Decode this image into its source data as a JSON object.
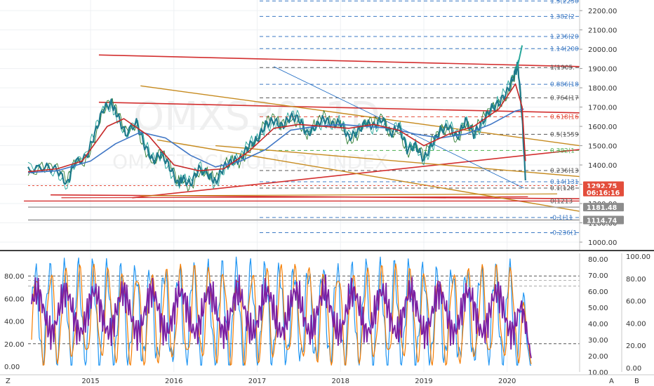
{
  "chart_data": [
    {
      "type": "line",
      "x_ticks": [
        "2015",
        "2016",
        "2017",
        "2018",
        "2019",
        "2020"
      ],
      "x_range": [
        2014.25,
        2020.87
      ],
      "y_ticks": [
        1000,
        1100,
        1200,
        1300,
        1400,
        1500,
        1600,
        1700,
        1800,
        1900,
        2000,
        2100,
        2200
      ],
      "y_tick_labels": [
        "1000.00",
        "1100.00",
        "1200.00",
        "1300.00",
        "1400.00",
        "1500.00",
        "1600.00",
        "1700.00",
        "1800.00",
        "1900.00",
        "2000.00",
        "2100.00",
        "2200.00"
      ],
      "ylim": [
        960,
        2255
      ],
      "watermark": [
        "OMXS30, 1D",
        "OMX STOCKHOLM 30 INDEX"
      ],
      "price_labels": [
        {
          "value": 1292.75,
          "text": "1292.75",
          "color": "#e34d3b"
        },
        {
          "value": 1259,
          "text": "06:16:16",
          "color": "#e34d3b"
        },
        {
          "value": 1181.48,
          "text": "1181.48",
          "color": "#8c8c8c"
        },
        {
          "value": 1114.74,
          "text": "1114.74",
          "color": "#8c8c8c"
        }
      ],
      "fib_levels": [
        {
          "value": 2250,
          "text": "1.5(2250",
          "color": "#3d7ac4"
        },
        {
          "value": 2170,
          "text": "1.382(2",
          "color": "#3d7ac4"
        },
        {
          "value": 2066,
          "text": "1.236(20",
          "color": "#3d7ac4"
        },
        {
          "value": 2003,
          "text": "1.14(200",
          "color": "#3d7ac4"
        },
        {
          "value": 1905,
          "text": "1(1905.",
          "color": "#555555"
        },
        {
          "value": 1818,
          "text": "0.886(18",
          "color": "#3d7ac4"
        },
        {
          "value": 1748,
          "text": "0.764(17",
          "color": "#555555"
        },
        {
          "value": 1650,
          "text": "0.618(16",
          "color": "#e34d3b"
        },
        {
          "value": 1559,
          "text": "0.5(1559",
          "color": "#555555"
        },
        {
          "value": 1475,
          "text": "0.382(1",
          "color": "#4caf50"
        },
        {
          "value": 1371,
          "text": "0.236(13",
          "color": "#555555"
        },
        {
          "value": 1313,
          "text": "0.14(131",
          "color": "#3d7ac4"
        },
        {
          "value": 1280,
          "text": "0.1(128",
          "color": "#555555"
        },
        {
          "value": 1213,
          "text": "0(1213",
          "color": "#555555"
        },
        {
          "value": 1128,
          "text": "-0.1(11",
          "color": "#3d7ac4"
        },
        {
          "value": 1049,
          "text": "-0.236(1",
          "color": "#3d7ac4"
        }
      ],
      "series": [
        {
          "style": "price",
          "color": "#1f7a8c",
          "x": [
            2014.25,
            2014.45,
            2014.6,
            2014.72,
            2014.8,
            2014.95,
            2015.05,
            2015.15,
            2015.25,
            2015.32,
            2015.42,
            2015.55,
            2015.65,
            2015.75,
            2015.85,
            2015.95,
            2016.05,
            2016.1,
            2016.2,
            2016.3,
            2016.42,
            2016.5,
            2016.6,
            2016.7,
            2016.8,
            2016.9,
            2017.0,
            2017.1,
            2017.2,
            2017.3,
            2017.4,
            2017.5,
            2017.6,
            2017.7,
            2017.8,
            2017.9,
            2018.0,
            2018.1,
            2018.2,
            2018.3,
            2018.4,
            2018.5,
            2018.6,
            2018.7,
            2018.8,
            2018.9,
            2019.0,
            2019.1,
            2019.2,
            2019.3,
            2019.4,
            2019.5,
            2019.6,
            2019.7,
            2019.8,
            2019.9,
            2020.0,
            2020.08,
            2020.13,
            2020.18,
            2020.22
          ],
          "y": [
            1370,
            1390,
            1375,
            1300,
            1410,
            1440,
            1560,
            1690,
            1720,
            1660,
            1560,
            1620,
            1500,
            1420,
            1460,
            1390,
            1300,
            1330,
            1300,
            1380,
            1350,
            1310,
            1390,
            1420,
            1430,
            1500,
            1530,
            1610,
            1630,
            1600,
            1650,
            1640,
            1560,
            1600,
            1640,
            1610,
            1620,
            1540,
            1570,
            1620,
            1600,
            1640,
            1560,
            1600,
            1480,
            1500,
            1430,
            1510,
            1580,
            1600,
            1540,
            1630,
            1560,
            1620,
            1690,
            1720,
            1780,
            1860,
            1920,
            1650,
            1320
          ]
        },
        {
          "style": "ma",
          "color": "#3f76c5",
          "x": [
            2014.25,
            2014.6,
            2015.0,
            2015.3,
            2015.6,
            2015.9,
            2016.2,
            2016.5,
            2016.8,
            2017.1,
            2017.4,
            2017.7,
            2018.0,
            2018.3,
            2018.6,
            2018.9,
            2019.2,
            2019.5,
            2019.8,
            2020.1,
            2020.2
          ],
          "y": [
            1360,
            1370,
            1420,
            1510,
            1570,
            1540,
            1450,
            1390,
            1420,
            1480,
            1580,
            1600,
            1610,
            1600,
            1590,
            1560,
            1540,
            1560,
            1610,
            1680,
            1690
          ]
        },
        {
          "style": "ma",
          "color": "#c62828",
          "x": [
            2014.25,
            2014.6,
            2014.9,
            2015.2,
            2015.4,
            2015.7,
            2016.0,
            2016.3,
            2016.6,
            2016.9,
            2017.2,
            2017.5,
            2017.8,
            2018.1,
            2018.4,
            2018.7,
            2019.0,
            2019.3,
            2019.6,
            2019.9,
            2020.1,
            2020.18,
            2020.22
          ],
          "y": [
            1365,
            1380,
            1420,
            1600,
            1640,
            1550,
            1400,
            1370,
            1380,
            1470,
            1590,
            1610,
            1600,
            1590,
            1610,
            1580,
            1500,
            1560,
            1600,
            1690,
            1820,
            1700,
            1420
          ]
        }
      ]
    },
    {
      "type": "line",
      "left_y_ticks": [
        0,
        20,
        40,
        60,
        80
      ],
      "left_y_tick_labels": [
        "0.00",
        "20.00",
        "40.00",
        "60.00",
        "80.00"
      ],
      "mid_y_ticks": [
        10,
        20,
        30,
        40,
        50,
        60,
        70,
        80
      ],
      "mid_y_tick_labels": [
        "10.00",
        "20.00",
        "30.00",
        "40.00",
        "50.00",
        "60.00",
        "70.00",
        "80.00"
      ],
      "right_y_ticks": [
        0,
        20,
        40,
        60,
        80,
        100
      ],
      "right_y_tick_labels": [
        "0.00",
        "20.00",
        "40.00",
        "60.00",
        "80.00",
        "100.00"
      ],
      "ylim": [
        -5,
        100
      ],
      "bottom_tags": [
        "Z",
        "A",
        "B"
      ],
      "series": [
        {
          "style": "osc_fast",
          "color": "#2196f3"
        },
        {
          "style": "osc_slow",
          "color": "#f57c00"
        },
        {
          "style": "osc_mid",
          "color": "#7b1fa2"
        }
      ]
    }
  ]
}
